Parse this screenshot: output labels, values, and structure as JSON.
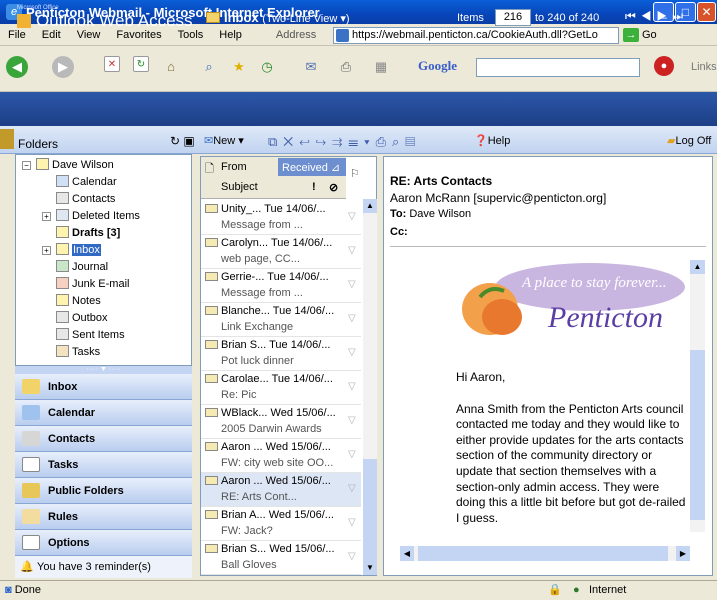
{
  "window": {
    "title": "Penticton Webmail - Microsoft Internet Explorer"
  },
  "menu": {
    "items": [
      "File",
      "Edit",
      "View",
      "Favorites",
      "Tools",
      "Help"
    ],
    "address_label": "Address",
    "url": "https://webmail.penticton.ca/CookieAuth.dll?GetLo",
    "go": "Go"
  },
  "toolbar": {
    "google": "Google",
    "links": "Links"
  },
  "owa": {
    "brand_small": "Microsoft Office",
    "brand": "Outlook Web Access",
    "folder": "Inbox",
    "view": "(Two-Line View ▾)",
    "items_label": "Items",
    "items_value": "216",
    "items_range": "to 240 of 240",
    "new": "New",
    "help": "Help",
    "logoff": "Log Off",
    "folders": "Folders"
  },
  "tree": [
    {
      "label": "Dave Wilson"
    },
    {
      "label": "Calendar"
    },
    {
      "label": "Contacts"
    },
    {
      "label": "Deleted Items"
    },
    {
      "label": "Drafts [3]"
    },
    {
      "label": "Inbox"
    },
    {
      "label": "Journal"
    },
    {
      "label": "Junk E-mail"
    },
    {
      "label": "Notes"
    },
    {
      "label": "Outbox"
    },
    {
      "label": "Sent Items"
    },
    {
      "label": "Tasks"
    }
  ],
  "nav": [
    "Inbox",
    "Calendar",
    "Contacts",
    "Tasks",
    "Public Folders",
    "Rules",
    "Options"
  ],
  "reminder": "You have 3 reminder(s)",
  "list_header": {
    "from": "From",
    "received": "Received",
    "subject": "Subject"
  },
  "messages": [
    {
      "from": "Unity_...",
      "date": "Tue 14/06/...",
      "subject": "Message from ..."
    },
    {
      "from": "Carolyn...",
      "date": "Tue 14/06/...",
      "subject": "web page, CC..."
    },
    {
      "from": "Gerrie-...",
      "date": "Tue 14/06/...",
      "subject": "Message from ..."
    },
    {
      "from": "Blanche...",
      "date": "Tue 14/06/...",
      "subject": "Link Exchange"
    },
    {
      "from": "Brian S...",
      "date": "Tue 14/06/...",
      "subject": "Pot luck dinner"
    },
    {
      "from": "Carolae...",
      "date": "Tue 14/06/...",
      "subject": "Re: Pic"
    },
    {
      "from": "WBlack...",
      "date": "Wed 15/06/...",
      "subject": "2005 Darwin Awards"
    },
    {
      "from": "Aaron ...",
      "date": "Wed 15/06/...",
      "subject": "FW: city web site OO..."
    },
    {
      "from": "Aaron ...",
      "date": "Wed 15/06/...",
      "subject": "RE: Arts Cont..."
    },
    {
      "from": "Brian A...",
      "date": "Wed 15/06/...",
      "subject": "FW: Jack?"
    },
    {
      "from": "Brian S...",
      "date": "Wed 15/06/...",
      "subject": "Ball Gloves"
    }
  ],
  "reading": {
    "subject": "RE: Arts Contacts",
    "from": "Aaron McRann [supervic@penticton.org]",
    "to_label": "To:",
    "to": "Dave Wilson",
    "cc_label": "Cc:",
    "logo_tagline": "A place to stay forever...",
    "logo_name": "Penticton",
    "greeting": "Hi Aaron,",
    "body": "Anna Smith from the Penticton Arts council contacted me today and they would like to either provide updates for the arts contacts section of the community directory or update that section themselves with a section-only admin access. They were doing this a little bit before but got de-railed I guess."
  },
  "status": {
    "left": "Done",
    "zone": "Internet"
  }
}
